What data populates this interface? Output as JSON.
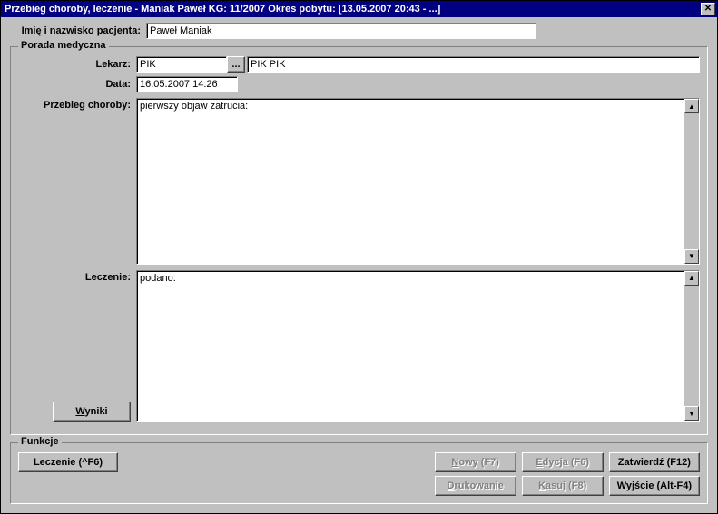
{
  "window": {
    "title": "Przebieg choroby, leczenie - Maniak Paweł KG: 11/2007 Okres pobytu: [13.05.2007 20:43 - ...]"
  },
  "header": {
    "patient_label": "Imię i nazwisko pacjenta:",
    "patient_name": "Paweł Maniak"
  },
  "advice": {
    "legend": "Porada medyczna",
    "doctor_label": "Lekarz:",
    "doctor_code": "PIK",
    "doctor_pick": "...",
    "doctor_name": "PIK PIK",
    "date_label": "Data:",
    "date_value": "16.05.2007 14:26",
    "course_label": "Przebieg choroby:",
    "course_text": "pierwszy objaw zatrucia:",
    "treatment_label": "Leczenie:",
    "treatment_text": "podano:",
    "results_btn": "Wyniki"
  },
  "functions": {
    "legend": "Funkcje",
    "leczenie": "Leczenie (^F6)",
    "nowy": "Nowy (F7)",
    "edycja": "Edycja (F6)",
    "zatwierdz": "Zatwierdź (F12)",
    "drukowanie": "Drukowanie",
    "kasuj": "Kasuj (F8)",
    "wyjscie": "Wyjście (Alt-F4)"
  }
}
